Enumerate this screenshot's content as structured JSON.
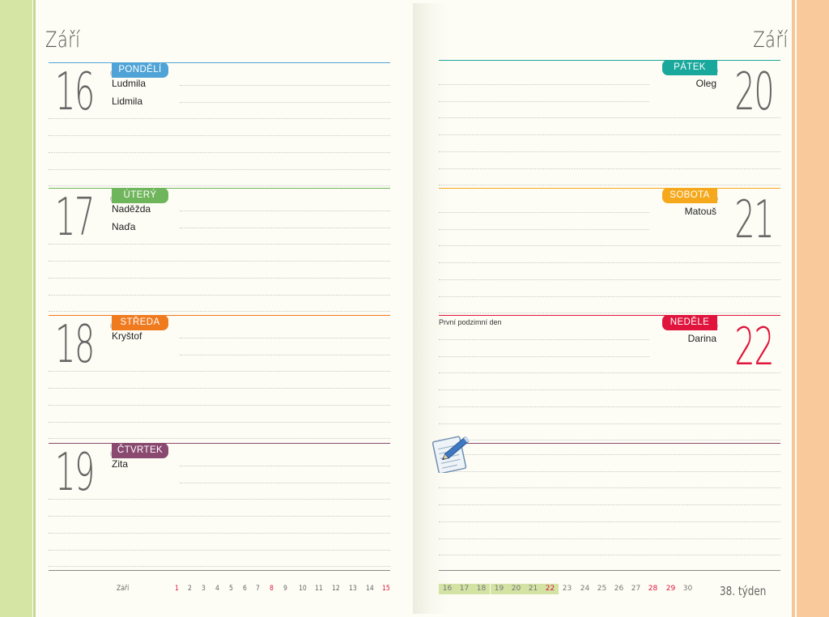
{
  "month_left": "Září",
  "month_right": "Září",
  "colors": {
    "teal": "#19a89c",
    "green": "#6fb55b",
    "orange": "#f07a1e",
    "purple": "#8a4a70",
    "blue": "#4fa3d6",
    "yellow": "#f5a81c",
    "red": "#e0143c"
  },
  "days": [
    {
      "num": "16",
      "label": "PONDĚLÍ",
      "names": [
        "Ludmila",
        "Lidmila"
      ],
      "note": ""
    },
    {
      "num": "17",
      "label": "ÚTERÝ",
      "names": [
        "Naděžda",
        "Naďa"
      ],
      "note": ""
    },
    {
      "num": "18",
      "label": "STŘEDA",
      "names": [
        "Kryštof"
      ],
      "note": ""
    },
    {
      "num": "19",
      "label": "ČTVRTEK",
      "names": [
        "Zita"
      ],
      "note": ""
    },
    {
      "num": "20",
      "label": "PÁTEK",
      "names": [
        "Oleg"
      ],
      "note": ""
    },
    {
      "num": "21",
      "label": "SOBOTA",
      "names": [
        "Matouš"
      ],
      "note": ""
    },
    {
      "num": "22",
      "label": "NEDĚLE",
      "names": [
        "Darina"
      ],
      "note": "První podzimní den"
    }
  ],
  "mini_cal_left": {
    "label": "Září",
    "days": [
      "1",
      "2",
      "3",
      "4",
      "5",
      "6",
      "7",
      "8",
      "9",
      "10",
      "11",
      "12",
      "13",
      "14",
      "15"
    ],
    "red_days": [
      "1",
      "8",
      "15"
    ]
  },
  "mini_cal_right": {
    "days": [
      "16",
      "17",
      "18",
      "19",
      "20",
      "21",
      "22",
      "23",
      "24",
      "25",
      "26",
      "27",
      "28",
      "29",
      "30"
    ],
    "highlighted": [
      "16",
      "17",
      "18",
      "19",
      "20",
      "21",
      "22"
    ],
    "red_days": [
      "22",
      "28",
      "29"
    ]
  },
  "week_label": "38. týden",
  "notes_icon": "notepad-pencil-icon"
}
